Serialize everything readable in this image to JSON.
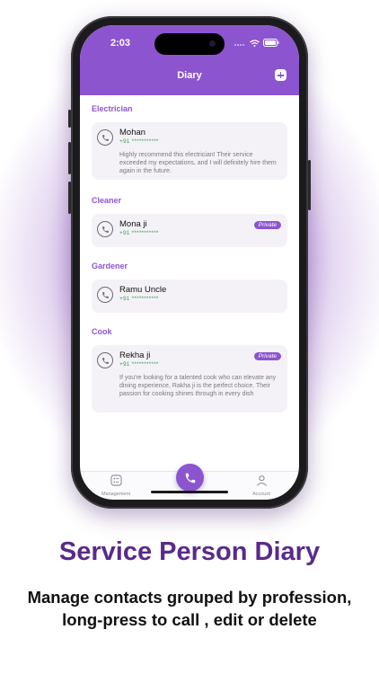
{
  "status_bar": {
    "time": "2:03"
  },
  "header": {
    "title": "Diary"
  },
  "sections": [
    {
      "label": "Electrician",
      "contacts": [
        {
          "name": "Mohan",
          "phone": "+91 ***********",
          "note": "Highly recommend this electrician! Their service exceeded my expectations, and I will definitely hire them again in the future.",
          "badge": ""
        }
      ]
    },
    {
      "label": "Cleaner",
      "contacts": [
        {
          "name": "Mona ji",
          "phone": "+91 ***********",
          "note": "",
          "badge": "Private"
        }
      ]
    },
    {
      "label": "Gardener",
      "contacts": [
        {
          "name": "Ramu Uncle",
          "phone": "+91 ***********",
          "note": "",
          "badge": ""
        }
      ]
    },
    {
      "label": "Cook",
      "contacts": [
        {
          "name": "Rekha ji",
          "phone": "+91 ***********",
          "note": "If you're looking for a talented cook who can elevate any dining experience, Rakha ji is the perfect choice. Their passion for cooking shines through in every dish",
          "badge": "Private"
        }
      ]
    }
  ],
  "tabbar": {
    "management_label": "Management",
    "account_label": "Account"
  },
  "promo": {
    "headline": "Service Person Diary",
    "subline_1": "Manage contacts grouped by profession,",
    "subline_2": "long-press to call , edit or delete"
  },
  "colors": {
    "accent": "#8c55cf",
    "phone_green": "#3aa35a",
    "headline": "#5a2a8a"
  }
}
